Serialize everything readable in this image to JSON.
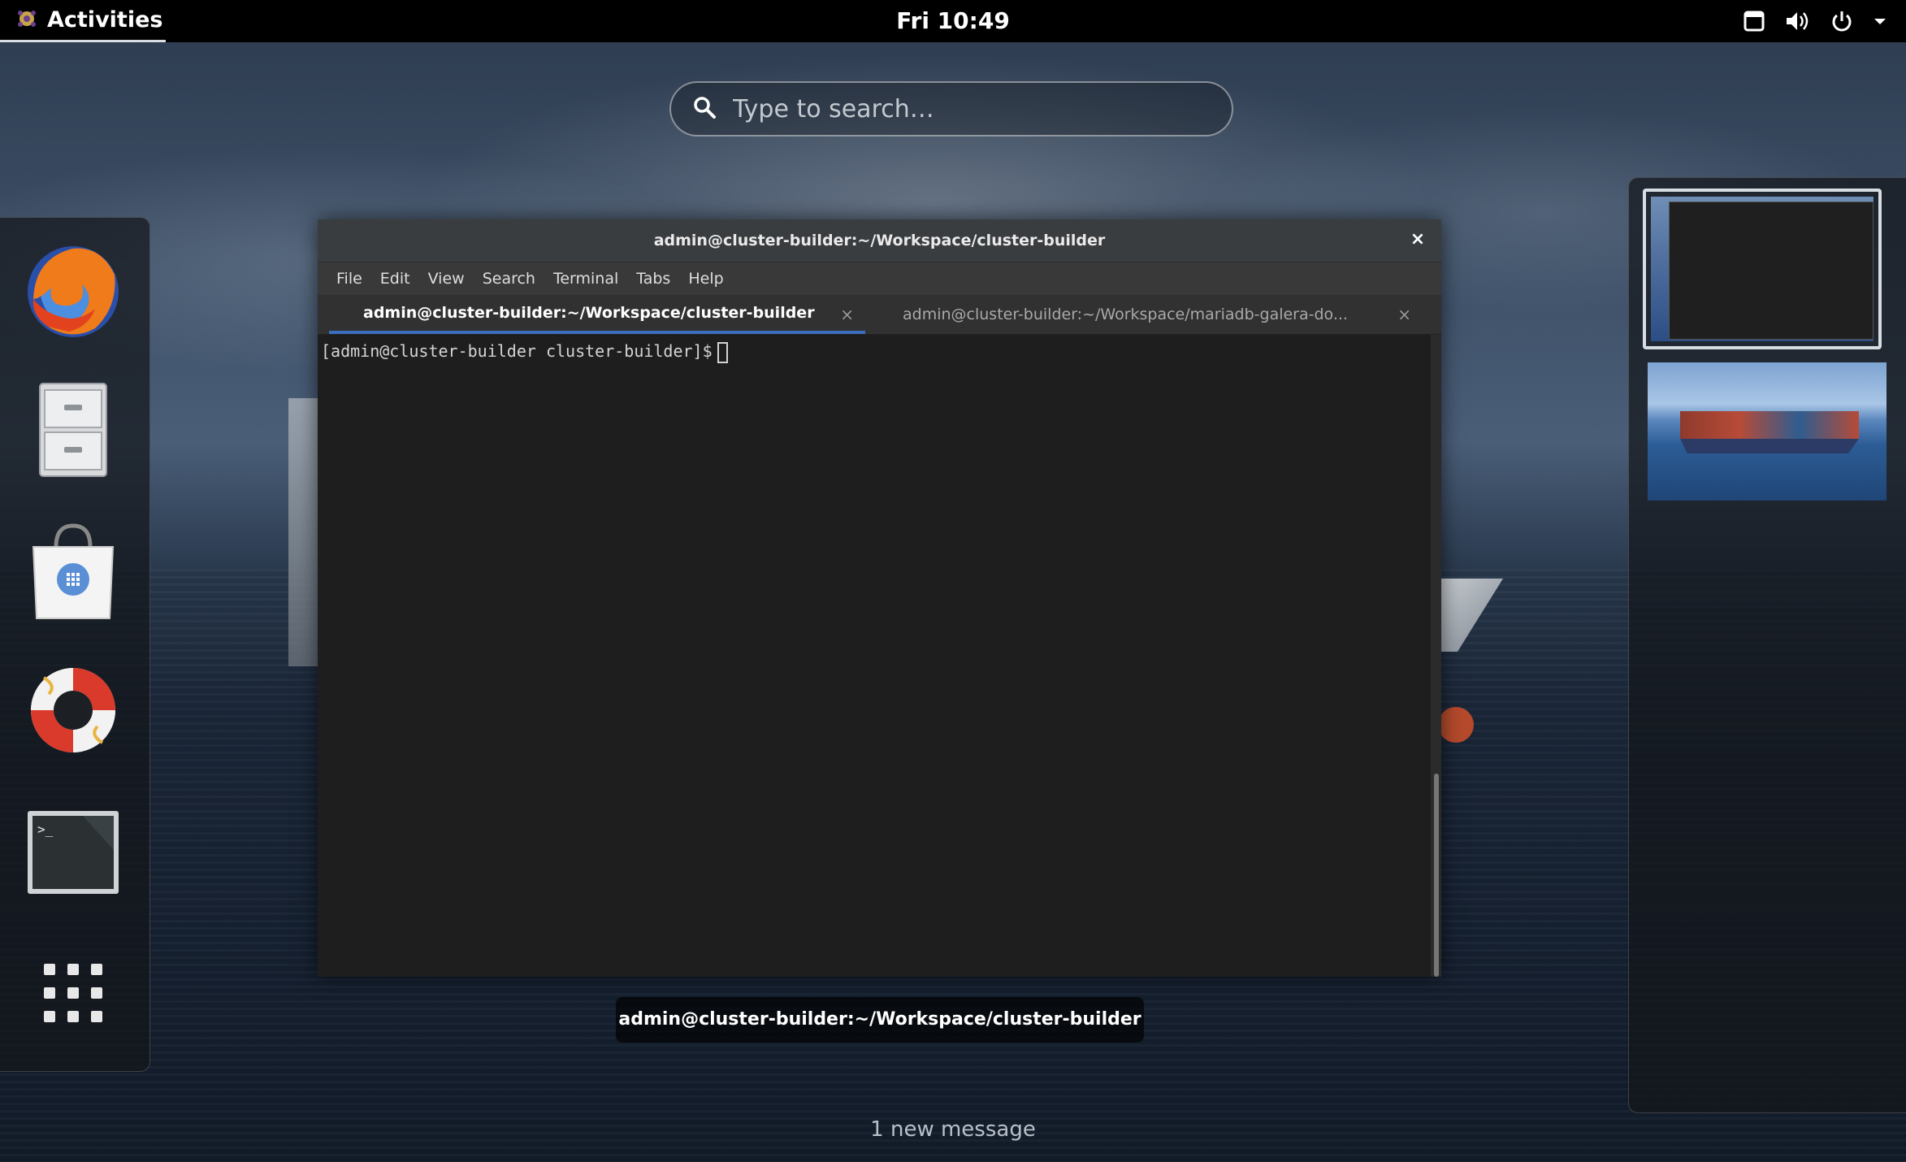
{
  "topbar": {
    "activities_label": "Activities",
    "clock": "Fri 10:49",
    "tray_icons": [
      "screen-icon",
      "volume-icon",
      "power-icon",
      "chevron-down-icon"
    ]
  },
  "search": {
    "placeholder": "Type to search…"
  },
  "dash": {
    "apps": [
      {
        "name": "Firefox",
        "icon": "firefox-icon"
      },
      {
        "name": "Files",
        "icon": "file-cabinet-icon"
      },
      {
        "name": "Software",
        "icon": "shopping-bag-icon"
      },
      {
        "name": "Help",
        "icon": "lifebuoy-icon"
      },
      {
        "name": "Terminal",
        "icon": "terminal-icon"
      },
      {
        "name": "Show Applications",
        "icon": "app-grid-icon"
      }
    ]
  },
  "window": {
    "title": "admin@cluster-builder:~/Workspace/cluster-builder",
    "close_glyph": "×",
    "menu": [
      "File",
      "Edit",
      "View",
      "Search",
      "Terminal",
      "Tabs",
      "Help"
    ],
    "tabs": [
      {
        "label": "admin@cluster-builder:~/Workspace/cluster-builder",
        "active": true
      },
      {
        "label": "admin@cluster-builder:~/Workspace/mariadb-galera-do...",
        "active": false
      }
    ],
    "tab_close_glyph": "×",
    "prompt": "[admin@cluster-builder cluster-builder]$"
  },
  "window_caption": "admin@cluster-builder:~/Workspace/cluster-builder",
  "notification": "1 new message",
  "colors": {
    "accent": "#3b6fbd",
    "topbar": "#000000",
    "terminal_bg": "#1e1e1e"
  }
}
